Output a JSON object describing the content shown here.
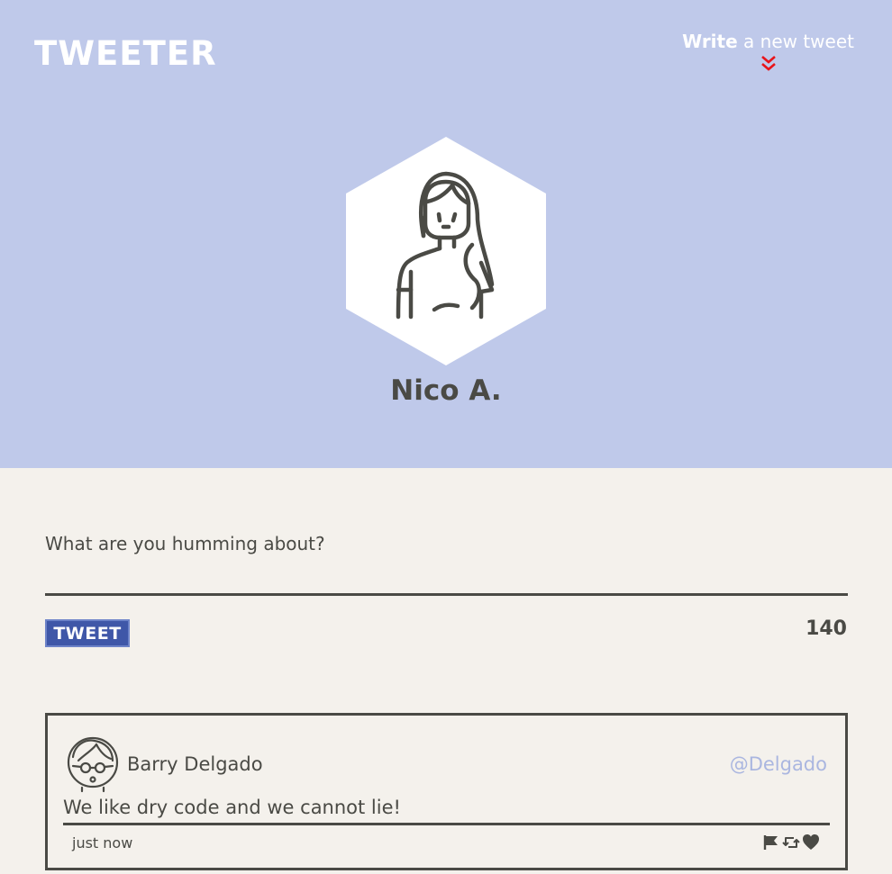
{
  "header": {
    "brand": "TWEETER",
    "compose_toggle": {
      "strong": "Write",
      "rest": "a new tweet",
      "icon": "double-chevron-down-icon",
      "icon_color": "#e8141a"
    }
  },
  "profile": {
    "name": "Nico A.",
    "avatar": "woman-avatar-icon"
  },
  "composer": {
    "placeholder": "What are you humming about?",
    "value": "",
    "button_label": "TWEET",
    "char_count": "140"
  },
  "tweets": [
    {
      "author": "Barry Delgado",
      "handle": "@Delgado",
      "avatar": "man-with-glasses-avatar-icon",
      "content": "We like dry code and we cannot lie!",
      "time": "just now",
      "actions": [
        "flag-icon",
        "retweet-icon",
        "heart-icon"
      ]
    }
  ],
  "colors": {
    "header_bg": "#bfc9ea",
    "page_bg": "#f4f1ec",
    "text": "#4a4a45",
    "button_bg": "#3f57a8",
    "handle": "#aab6e0"
  }
}
